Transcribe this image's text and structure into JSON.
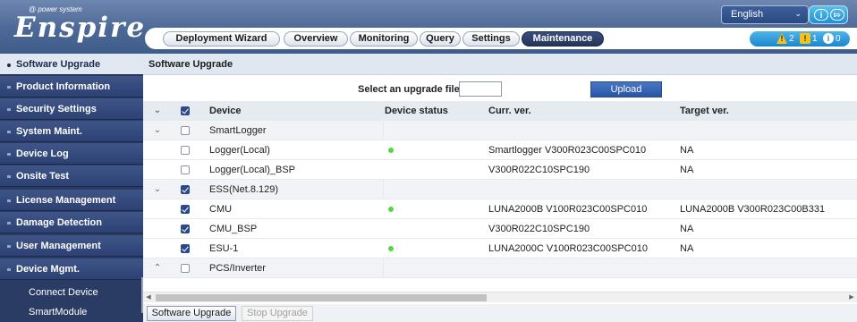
{
  "header": {
    "logo_subtitle": "@ power system",
    "logo_text": "Enspire",
    "language": "English",
    "nav_tabs": [
      {
        "label": "Deployment Wizard",
        "active": false
      },
      {
        "label": "Overview",
        "active": false
      },
      {
        "label": "Monitoring",
        "active": false
      },
      {
        "label": "Query",
        "active": false
      },
      {
        "label": "Settings",
        "active": false
      },
      {
        "label": "Maintenance",
        "active": true
      }
    ],
    "alarms": {
      "major": "2",
      "minor": "1",
      "warning": "0"
    }
  },
  "sidebar": {
    "items": [
      {
        "label": "Software Upgrade",
        "active": true
      },
      {
        "label": "Product Information",
        "active": false
      },
      {
        "label": "Security Settings",
        "active": false
      },
      {
        "label": "System Maint.",
        "active": false
      },
      {
        "label": "Device Log",
        "active": false
      },
      {
        "label": "Onsite Test",
        "active": false
      },
      {
        "label": "License Management",
        "active": false
      },
      {
        "label": "Damage Detection",
        "active": false
      },
      {
        "label": "User Management",
        "active": false
      },
      {
        "label": "Device Mgmt.",
        "active": false
      }
    ],
    "sub_items": [
      {
        "label": "Connect Device"
      },
      {
        "label": "SmartModule"
      }
    ]
  },
  "main": {
    "title": "Software Upgrade",
    "upload_label": "Select an upgrade file:",
    "upload_button": "Upload",
    "table": {
      "columns": [
        "Device",
        "Device status",
        "Curr. ver.",
        "Target ver."
      ],
      "header_checked": true,
      "rows": [
        {
          "type": "group",
          "expanded": true,
          "checked": false,
          "device": "SmartLogger"
        },
        {
          "type": "item",
          "checked": false,
          "device": "Logger(Local)",
          "status": "online",
          "curr": "Smartlogger V300R023C00SPC010",
          "target": "NA"
        },
        {
          "type": "item",
          "checked": false,
          "device": "Logger(Local)_BSP",
          "status": "",
          "curr": "V300R022C10SPC190",
          "target": "NA"
        },
        {
          "type": "group",
          "expanded": true,
          "checked": true,
          "device": "ESS(Net.8.129)"
        },
        {
          "type": "item",
          "checked": true,
          "device": "CMU",
          "status": "online",
          "curr": "LUNA2000B V100R023C00SPC010",
          "target": "LUNA2000B V300R023C00B331"
        },
        {
          "type": "item",
          "checked": true,
          "device": "CMU_BSP",
          "status": "",
          "curr": "V300R022C10SPC190",
          "target": "NA"
        },
        {
          "type": "item",
          "checked": true,
          "device": "ESU-1",
          "status": "online",
          "curr": "LUNA2000C V100R023C00SPC010",
          "target": "NA"
        },
        {
          "type": "group",
          "expanded": false,
          "checked": false,
          "device": "PCS/Inverter"
        }
      ]
    },
    "buttons": {
      "software_upgrade": "Software Upgrade",
      "stop_upgrade": "Stop Upgrade"
    }
  },
  "colors": {
    "accent": "#2b4a8c",
    "online": "#5bd24b",
    "header": "#4c6896"
  }
}
